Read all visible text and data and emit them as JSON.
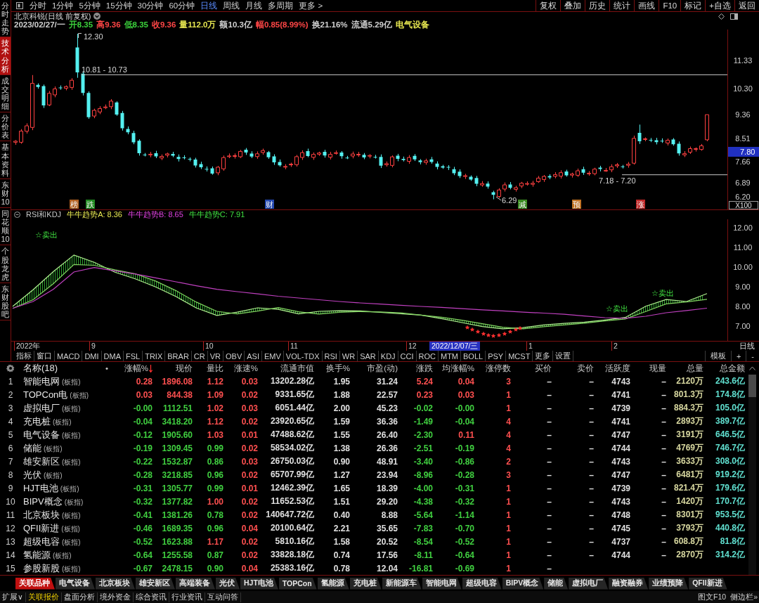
{
  "sidebar": {
    "tabs": [
      {
        "label": "分时走势",
        "selected": false
      },
      {
        "label": "技术分析",
        "selected": true
      },
      {
        "label": "成交明细",
        "selected": false
      },
      {
        "label": "分价表",
        "selected": false
      },
      {
        "label": "基本资料",
        "selected": false
      },
      {
        "label": "东财10",
        "selected": false
      },
      {
        "label": "同花顺10",
        "selected": false
      },
      {
        "label": "个股龙虎",
        "selected": false
      },
      {
        "label": "东财股吧",
        "selected": false
      }
    ]
  },
  "toolbar": {
    "periods": [
      {
        "label": "分时",
        "selected": false
      },
      {
        "label": "1分钟",
        "selected": false
      },
      {
        "label": "5分钟",
        "selected": false
      },
      {
        "label": "15分钟",
        "selected": false
      },
      {
        "label": "30分钟",
        "selected": false
      },
      {
        "label": "60分钟",
        "selected": false
      },
      {
        "label": "日线",
        "selected": true
      },
      {
        "label": "周线",
        "selected": false
      },
      {
        "label": "月线",
        "selected": false
      },
      {
        "label": "多周期",
        "selected": false
      },
      {
        "label": "更多 >",
        "selected": false
      }
    ],
    "buttons": [
      "复权",
      "叠加",
      "历史",
      "统计",
      "画线",
      "F10",
      "标记",
      "+自选",
      "返回"
    ]
  },
  "chart_header": {
    "title": "北京科锐(日线 前复权)",
    "quote": [
      {
        "text": "2023/02/27/一",
        "color": "#d0d0d0"
      },
      {
        "text": "开8.35",
        "color": "#3cd23c"
      },
      {
        "text": "高9.36",
        "color": "#ff4646"
      },
      {
        "text": "低8.35",
        "color": "#3cd23c"
      },
      {
        "text": "收9.36",
        "color": "#ff4646"
      },
      {
        "text": "量112.0万",
        "color": "#e6e650"
      },
      {
        "text": "额10.3亿",
        "color": "#d0d0d0"
      },
      {
        "text": "幅0.85(8.99%)",
        "color": "#ff4646"
      },
      {
        "text": "换21.16%",
        "color": "#d0d0d0"
      },
      {
        "text": "流通5.29亿",
        "color": "#d0d0d0"
      },
      {
        "text": "电气设备",
        "color": "#e6e650"
      }
    ]
  },
  "price_chart": {
    "annotations": [
      "12.30",
      "10.81 - 10.73",
      "7.18 - 7.20",
      "6.29"
    ],
    "event_marks": [
      {
        "text": "榜",
        "color": "#b06020"
      },
      {
        "text": "跌",
        "color": "#208a20"
      },
      {
        "text": "财",
        "color": "#2448b0"
      },
      {
        "text": "减",
        "color": "#3a8a20"
      },
      {
        "text": "预",
        "color": "#c07020"
      },
      {
        "text": "涨",
        "color": "#c02828"
      }
    ],
    "axis_labels": [
      "11.33",
      "10.30",
      "9.36",
      "8.51",
      "7.66",
      "6.89",
      "6.20"
    ],
    "last_price": "7.80",
    "scale": "X100"
  },
  "indicator": {
    "title": "RSI和KDJ",
    "legend": [
      {
        "text": "牛牛趋势A: 8.36",
        "color": "#e6e650"
      },
      {
        "text": "牛牛趋势B: 8.65",
        "color": "#e040e0"
      },
      {
        "text": "牛牛趋势C: 7.91",
        "color": "#40e040"
      }
    ],
    "signals": [
      "☆卖出",
      "☆卖出",
      "☆卖出"
    ],
    "chart_data": {
      "type": "line",
      "series": [
        {
          "color": "#b0f090",
          "values": [
            8.0,
            8.85,
            9.78,
            10.61,
            10.24,
            9.74,
            9.4,
            8.99,
            8.5,
            7.92,
            7.54,
            7.71,
            7.93,
            7.85,
            7.62,
            7.75,
            7.78,
            7.77,
            7.7,
            7.63,
            7.56,
            7.38,
            7.18,
            6.98,
            6.86,
            6.92,
            7.06,
            7.14,
            7.2,
            7.31,
            7.44,
            8.01,
            8.35,
            8.25,
            8.65
          ]
        },
        {
          "color": "#80d060",
          "values": [
            7.9,
            8.34,
            9.16,
            10.13,
            10.09,
            9.86,
            9.66,
            9.29,
            8.8,
            8.22,
            7.75,
            7.62,
            7.76,
            7.94,
            7.73,
            7.61,
            7.7,
            7.74,
            7.72,
            7.67,
            7.56,
            7.45,
            7.3,
            7.12,
            6.94,
            6.86,
            6.97,
            7.06,
            7.15,
            7.26,
            7.36,
            7.74,
            8.13,
            8.23,
            8.36
          ]
        },
        {
          "color": "#c040c0",
          "values": [
            7.9,
            8.25,
            8.88,
            9.75,
            9.98,
            9.81,
            9.65,
            9.45,
            9.25,
            9.05,
            8.87,
            8.75,
            8.64,
            8.52,
            8.43,
            8.34,
            8.25,
            8.18,
            8.12,
            8.06,
            8.0,
            7.95,
            7.89,
            7.83,
            7.77,
            7.71,
            7.66,
            7.6,
            7.51,
            7.43,
            7.4,
            7.5,
            7.68,
            7.79,
            7.91
          ]
        }
      ],
      "ylim": [
        6.25,
        12.43
      ],
      "yticks": [
        {
          "value": 12,
          "label": "12.00"
        },
        {
          "value": 11,
          "label": "11.00"
        },
        {
          "value": 10,
          "label": "10.00"
        },
        {
          "value": 9,
          "label": "9.00"
        },
        {
          "value": 8,
          "label": "8.00"
        },
        {
          "value": 7,
          "label": "7.00"
        }
      ]
    }
  },
  "time_axis": {
    "labels": [
      {
        "text": "2022年",
        "kind": "tick"
      },
      {
        "text": "9",
        "kind": "tick"
      },
      {
        "text": "10",
        "kind": "tick"
      },
      {
        "text": "11",
        "kind": "tick"
      },
      {
        "text": "12",
        "kind": "tick"
      },
      {
        "text": "2022/12/07/三",
        "kind": "cursor"
      },
      {
        "text": "1",
        "kind": "tick"
      },
      {
        "text": "2",
        "kind": "tick"
      }
    ],
    "period": "日线"
  },
  "indicator_tabs": {
    "items": [
      "指标",
      "窗口",
      "MACD",
      "DMI",
      "DMA",
      "FSL",
      "TRIX",
      "BRAR",
      "CR",
      "VR",
      "OBV",
      "ASI",
      "EMV",
      "VOL-TDX",
      "RSI",
      "WR",
      "SAR",
      "KDJ",
      "CCI",
      "ROC",
      "MTM",
      "BOLL",
      "PSY",
      "MCST",
      "更多",
      "设置"
    ],
    "tools": [
      "模板",
      "+",
      "-"
    ]
  },
  "table": {
    "name_header": "名称(18)",
    "marker": "•",
    "columns": [
      {
        "label": "涨幅%",
        "sorted": true
      },
      {
        "label": "现价",
        "sorted": false
      },
      {
        "label": "量比",
        "sorted": false
      },
      {
        "label": "涨速%",
        "sorted": false
      },
      {
        "label": "流通市值",
        "sorted": false
      },
      {
        "label": "换手%",
        "sorted": false
      },
      {
        "label": "市盈(动)",
        "sorted": false
      },
      {
        "label": "涨跌",
        "sorted": false
      },
      {
        "label": "均涨幅%",
        "sorted": false
      },
      {
        "label": "涨停数",
        "sorted": false
      },
      {
        "label": "买价",
        "sorted": false
      },
      {
        "label": "卖价",
        "sorted": false
      },
      {
        "label": "活跃度",
        "sorted": false
      },
      {
        "label": "现量",
        "sorted": false
      },
      {
        "label": "总量",
        "sorted": false
      },
      {
        "label": "总金额",
        "sorted": false
      }
    ],
    "rows": [
      {
        "index": "1",
        "name": "智能电网",
        "tag": "(板指)",
        "cells": [
          {
            "text": "0.28",
            "color": "#ff5050"
          },
          {
            "text": "1896.08",
            "color": "#ff5050"
          },
          {
            "text": "1.12",
            "color": "#ff5050"
          },
          {
            "text": "0.03",
            "color": "#ff5050"
          },
          {
            "text": "13202.28亿",
            "color": "#e0e0e0"
          },
          {
            "text": "1.95",
            "color": "#e0e0e0"
          },
          {
            "text": "31.24",
            "color": "#e0e0e0"
          },
          {
            "text": "5.24",
            "color": "#ff5050"
          },
          {
            "text": "0.04",
            "color": "#ff5050"
          },
          {
            "text": "3",
            "color": "#ff5050"
          },
          {
            "text": "–",
            "color": "#e0e0e0"
          },
          {
            "text": "–",
            "color": "#e0e0e0"
          },
          {
            "text": "4743",
            "color": "#e0e0e0"
          },
          {
            "text": "–",
            "color": "#e0e0e0"
          },
          {
            "text": "2120万",
            "color": "#d8d8a0"
          },
          {
            "text": "243.6亿",
            "color": "#60e0d0"
          }
        ]
      },
      {
        "index": "2",
        "name": "TOPCon电",
        "tag": "(板指)",
        "cells": [
          {
            "text": "0.03",
            "color": "#ff5050"
          },
          {
            "text": "844.38",
            "color": "#ff5050"
          },
          {
            "text": "1.09",
            "color": "#ff5050"
          },
          {
            "text": "0.02",
            "color": "#ff5050"
          },
          {
            "text": "9331.65亿",
            "color": "#e0e0e0"
          },
          {
            "text": "1.88",
            "color": "#e0e0e0"
          },
          {
            "text": "22.57",
            "color": "#e0e0e0"
          },
          {
            "text": "0.23",
            "color": "#ff5050"
          },
          {
            "text": "0.03",
            "color": "#ff5050"
          },
          {
            "text": "1",
            "color": "#ff5050"
          },
          {
            "text": "–",
            "color": "#e0e0e0"
          },
          {
            "text": "–",
            "color": "#e0e0e0"
          },
          {
            "text": "4741",
            "color": "#e0e0e0"
          },
          {
            "text": "–",
            "color": "#e0e0e0"
          },
          {
            "text": "801.3万",
            "color": "#d8d8a0"
          },
          {
            "text": "174.8亿",
            "color": "#60e0d0"
          }
        ]
      },
      {
        "index": "3",
        "name": "虚拟电厂",
        "tag": "(板指)",
        "cells": [
          {
            "text": "-0.00",
            "color": "#40d040"
          },
          {
            "text": "1112.51",
            "color": "#40d040"
          },
          {
            "text": "1.02",
            "color": "#ff5050"
          },
          {
            "text": "0.03",
            "color": "#ff5050"
          },
          {
            "text": "6051.44亿",
            "color": "#e0e0e0"
          },
          {
            "text": "2.00",
            "color": "#e0e0e0"
          },
          {
            "text": "45.23",
            "color": "#e0e0e0"
          },
          {
            "text": "-0.02",
            "color": "#40d040"
          },
          {
            "text": "-0.00",
            "color": "#40d040"
          },
          {
            "text": "1",
            "color": "#ff5050"
          },
          {
            "text": "–",
            "color": "#e0e0e0"
          },
          {
            "text": "–",
            "color": "#e0e0e0"
          },
          {
            "text": "4739",
            "color": "#e0e0e0"
          },
          {
            "text": "–",
            "color": "#e0e0e0"
          },
          {
            "text": "884.3万",
            "color": "#d8d8a0"
          },
          {
            "text": "105.0亿",
            "color": "#60e0d0"
          }
        ]
      },
      {
        "index": "4",
        "name": "充电桩",
        "tag": "(板指)",
        "cells": [
          {
            "text": "-0.04",
            "color": "#40d040"
          },
          {
            "text": "3418.20",
            "color": "#40d040"
          },
          {
            "text": "1.12",
            "color": "#ff5050"
          },
          {
            "text": "0.02",
            "color": "#ff5050"
          },
          {
            "text": "23920.65亿",
            "color": "#e0e0e0"
          },
          {
            "text": "1.59",
            "color": "#e0e0e0"
          },
          {
            "text": "36.36",
            "color": "#e0e0e0"
          },
          {
            "text": "-1.49",
            "color": "#40d040"
          },
          {
            "text": "-0.04",
            "color": "#40d040"
          },
          {
            "text": "4",
            "color": "#ff5050"
          },
          {
            "text": "–",
            "color": "#e0e0e0"
          },
          {
            "text": "–",
            "color": "#e0e0e0"
          },
          {
            "text": "4741",
            "color": "#e0e0e0"
          },
          {
            "text": "–",
            "color": "#e0e0e0"
          },
          {
            "text": "2893万",
            "color": "#d8d8a0"
          },
          {
            "text": "389.7亿",
            "color": "#60e0d0"
          }
        ]
      },
      {
        "index": "5",
        "name": "电气设备",
        "tag": "(板指)",
        "cells": [
          {
            "text": "-0.12",
            "color": "#40d040"
          },
          {
            "text": "1905.60",
            "color": "#40d040"
          },
          {
            "text": "1.03",
            "color": "#ff5050"
          },
          {
            "text": "0.01",
            "color": "#ff5050"
          },
          {
            "text": "47488.62亿",
            "color": "#e0e0e0"
          },
          {
            "text": "1.55",
            "color": "#e0e0e0"
          },
          {
            "text": "26.40",
            "color": "#e0e0e0"
          },
          {
            "text": "-2.30",
            "color": "#40d040"
          },
          {
            "text": "0.11",
            "color": "#ff5050"
          },
          {
            "text": "4",
            "color": "#ff5050"
          },
          {
            "text": "–",
            "color": "#e0e0e0"
          },
          {
            "text": "–",
            "color": "#e0e0e0"
          },
          {
            "text": "4747",
            "color": "#e0e0e0"
          },
          {
            "text": "–",
            "color": "#e0e0e0"
          },
          {
            "text": "3191万",
            "color": "#d8d8a0"
          },
          {
            "text": "646.5亿",
            "color": "#60e0d0"
          }
        ]
      },
      {
        "index": "6",
        "name": "储能",
        "tag": "(板指)",
        "cells": [
          {
            "text": "-0.19",
            "color": "#40d040"
          },
          {
            "text": "1309.45",
            "color": "#40d040"
          },
          {
            "text": "0.99",
            "color": "#40d040"
          },
          {
            "text": "0.02",
            "color": "#ff5050"
          },
          {
            "text": "58534.02亿",
            "color": "#e0e0e0"
          },
          {
            "text": "1.38",
            "color": "#e0e0e0"
          },
          {
            "text": "26.36",
            "color": "#e0e0e0"
          },
          {
            "text": "-2.51",
            "color": "#40d040"
          },
          {
            "text": "-0.19",
            "color": "#40d040"
          },
          {
            "text": "4",
            "color": "#ff5050"
          },
          {
            "text": "–",
            "color": "#e0e0e0"
          },
          {
            "text": "–",
            "color": "#e0e0e0"
          },
          {
            "text": "4744",
            "color": "#e0e0e0"
          },
          {
            "text": "–",
            "color": "#e0e0e0"
          },
          {
            "text": "4769万",
            "color": "#d8d8a0"
          },
          {
            "text": "746.7亿",
            "color": "#60e0d0"
          }
        ]
      },
      {
        "index": "7",
        "name": "雄安新区",
        "tag": "(板指)",
        "cells": [
          {
            "text": "-0.22",
            "color": "#40d040"
          },
          {
            "text": "1532.87",
            "color": "#40d040"
          },
          {
            "text": "0.86",
            "color": "#40d040"
          },
          {
            "text": "0.03",
            "color": "#ff5050"
          },
          {
            "text": "26750.03亿",
            "color": "#e0e0e0"
          },
          {
            "text": "0.90",
            "color": "#e0e0e0"
          },
          {
            "text": "48.91",
            "color": "#e0e0e0"
          },
          {
            "text": "-3.40",
            "color": "#40d040"
          },
          {
            "text": "-0.86",
            "color": "#40d040"
          },
          {
            "text": "2",
            "color": "#ff5050"
          },
          {
            "text": "–",
            "color": "#e0e0e0"
          },
          {
            "text": "–",
            "color": "#e0e0e0"
          },
          {
            "text": "4743",
            "color": "#e0e0e0"
          },
          {
            "text": "–",
            "color": "#e0e0e0"
          },
          {
            "text": "3633万",
            "color": "#d8d8a0"
          },
          {
            "text": "308.0亿",
            "color": "#60e0d0"
          }
        ]
      },
      {
        "index": "8",
        "name": "光伏",
        "tag": "(板指)",
        "cells": [
          {
            "text": "-0.28",
            "color": "#40d040"
          },
          {
            "text": "3218.85",
            "color": "#40d040"
          },
          {
            "text": "0.96",
            "color": "#40d040"
          },
          {
            "text": "0.02",
            "color": "#ff5050"
          },
          {
            "text": "65707.99亿",
            "color": "#e0e0e0"
          },
          {
            "text": "1.27",
            "color": "#e0e0e0"
          },
          {
            "text": "23.94",
            "color": "#e0e0e0"
          },
          {
            "text": "-8.96",
            "color": "#40d040"
          },
          {
            "text": "-0.28",
            "color": "#40d040"
          },
          {
            "text": "3",
            "color": "#ff5050"
          },
          {
            "text": "–",
            "color": "#e0e0e0"
          },
          {
            "text": "–",
            "color": "#e0e0e0"
          },
          {
            "text": "4747",
            "color": "#e0e0e0"
          },
          {
            "text": "–",
            "color": "#e0e0e0"
          },
          {
            "text": "6481万",
            "color": "#d8d8a0"
          },
          {
            "text": "919.2亿",
            "color": "#60e0d0"
          }
        ]
      },
      {
        "index": "9",
        "name": "HJT电池",
        "tag": "(板指)",
        "cells": [
          {
            "text": "-0.31",
            "color": "#40d040"
          },
          {
            "text": "1305.77",
            "color": "#40d040"
          },
          {
            "text": "0.99",
            "color": "#40d040"
          },
          {
            "text": "0.01",
            "color": "#ff5050"
          },
          {
            "text": "12462.39亿",
            "color": "#e0e0e0"
          },
          {
            "text": "1.65",
            "color": "#e0e0e0"
          },
          {
            "text": "18.39",
            "color": "#e0e0e0"
          },
          {
            "text": "-4.00",
            "color": "#40d040"
          },
          {
            "text": "-0.31",
            "color": "#40d040"
          },
          {
            "text": "1",
            "color": "#ff5050"
          },
          {
            "text": "–",
            "color": "#e0e0e0"
          },
          {
            "text": "–",
            "color": "#e0e0e0"
          },
          {
            "text": "4739",
            "color": "#e0e0e0"
          },
          {
            "text": "–",
            "color": "#e0e0e0"
          },
          {
            "text": "821.4万",
            "color": "#d8d8a0"
          },
          {
            "text": "179.6亿",
            "color": "#60e0d0"
          }
        ]
      },
      {
        "index": "10",
        "name": "BIPV概念",
        "tag": "(板指)",
        "cells": [
          {
            "text": "-0.32",
            "color": "#40d040"
          },
          {
            "text": "1377.82",
            "color": "#40d040"
          },
          {
            "text": "1.00",
            "color": "#ff5050"
          },
          {
            "text": "0.02",
            "color": "#ff5050"
          },
          {
            "text": "11652.53亿",
            "color": "#e0e0e0"
          },
          {
            "text": "1.51",
            "color": "#e0e0e0"
          },
          {
            "text": "29.20",
            "color": "#e0e0e0"
          },
          {
            "text": "-4.38",
            "color": "#40d040"
          },
          {
            "text": "-0.32",
            "color": "#40d040"
          },
          {
            "text": "1",
            "color": "#ff5050"
          },
          {
            "text": "–",
            "color": "#e0e0e0"
          },
          {
            "text": "–",
            "color": "#e0e0e0"
          },
          {
            "text": "4743",
            "color": "#e0e0e0"
          },
          {
            "text": "–",
            "color": "#e0e0e0"
          },
          {
            "text": "1420万",
            "color": "#d8d8a0"
          },
          {
            "text": "170.7亿",
            "color": "#60e0d0"
          }
        ]
      },
      {
        "index": "11",
        "name": "北京板块",
        "tag": "(板指)",
        "cells": [
          {
            "text": "-0.41",
            "color": "#40d040"
          },
          {
            "text": "1381.26",
            "color": "#40d040"
          },
          {
            "text": "0.78",
            "color": "#40d040"
          },
          {
            "text": "0.02",
            "color": "#ff5050"
          },
          {
            "text": "140647.72亿",
            "color": "#e0e0e0"
          },
          {
            "text": "0.40",
            "color": "#e0e0e0"
          },
          {
            "text": "8.88",
            "color": "#e0e0e0"
          },
          {
            "text": "-5.64",
            "color": "#40d040"
          },
          {
            "text": "-1.14",
            "color": "#40d040"
          },
          {
            "text": "1",
            "color": "#ff5050"
          },
          {
            "text": "–",
            "color": "#e0e0e0"
          },
          {
            "text": "–",
            "color": "#e0e0e0"
          },
          {
            "text": "4748",
            "color": "#e0e0e0"
          },
          {
            "text": "–",
            "color": "#e0e0e0"
          },
          {
            "text": "8301万",
            "color": "#d8d8a0"
          },
          {
            "text": "953.5亿",
            "color": "#60e0d0"
          }
        ]
      },
      {
        "index": "12",
        "name": "QFII新进",
        "tag": "(板指)",
        "cells": [
          {
            "text": "-0.46",
            "color": "#40d040"
          },
          {
            "text": "1689.35",
            "color": "#40d040"
          },
          {
            "text": "0.96",
            "color": "#40d040"
          },
          {
            "text": "0.04",
            "color": "#ff5050"
          },
          {
            "text": "20100.64亿",
            "color": "#e0e0e0"
          },
          {
            "text": "2.21",
            "color": "#e0e0e0"
          },
          {
            "text": "35.65",
            "color": "#e0e0e0"
          },
          {
            "text": "-7.83",
            "color": "#40d040"
          },
          {
            "text": "-0.70",
            "color": "#40d040"
          },
          {
            "text": "1",
            "color": "#ff5050"
          },
          {
            "text": "–",
            "color": "#e0e0e0"
          },
          {
            "text": "–",
            "color": "#e0e0e0"
          },
          {
            "text": "4745",
            "color": "#e0e0e0"
          },
          {
            "text": "–",
            "color": "#e0e0e0"
          },
          {
            "text": "3793万",
            "color": "#d8d8a0"
          },
          {
            "text": "440.8亿",
            "color": "#60e0d0"
          }
        ]
      },
      {
        "index": "13",
        "name": "超级电容",
        "tag": "(板指)",
        "cells": [
          {
            "text": "-0.52",
            "color": "#40d040"
          },
          {
            "text": "1623.88",
            "color": "#40d040"
          },
          {
            "text": "1.17",
            "color": "#ff5050"
          },
          {
            "text": "0.02",
            "color": "#ff5050"
          },
          {
            "text": "5810.16亿",
            "color": "#e0e0e0"
          },
          {
            "text": "1.58",
            "color": "#e0e0e0"
          },
          {
            "text": "20.52",
            "color": "#e0e0e0"
          },
          {
            "text": "-8.54",
            "color": "#40d040"
          },
          {
            "text": "-0.52",
            "color": "#40d040"
          },
          {
            "text": "1",
            "color": "#ff5050"
          },
          {
            "text": "–",
            "color": "#e0e0e0"
          },
          {
            "text": "–",
            "color": "#e0e0e0"
          },
          {
            "text": "4737",
            "color": "#e0e0e0"
          },
          {
            "text": "–",
            "color": "#e0e0e0"
          },
          {
            "text": "608.8万",
            "color": "#d8d8a0"
          },
          {
            "text": "81.8亿",
            "color": "#60e0d0"
          }
        ]
      },
      {
        "index": "14",
        "name": "氢能源",
        "tag": "(板指)",
        "cells": [
          {
            "text": "-0.64",
            "color": "#40d040"
          },
          {
            "text": "1255.58",
            "color": "#40d040"
          },
          {
            "text": "0.87",
            "color": "#40d040"
          },
          {
            "text": "0.02",
            "color": "#ff5050"
          },
          {
            "text": "33828.18亿",
            "color": "#e0e0e0"
          },
          {
            "text": "0.74",
            "color": "#e0e0e0"
          },
          {
            "text": "17.56",
            "color": "#e0e0e0"
          },
          {
            "text": "-8.11",
            "color": "#40d040"
          },
          {
            "text": "-0.64",
            "color": "#40d040"
          },
          {
            "text": "1",
            "color": "#ff5050"
          },
          {
            "text": "–",
            "color": "#e0e0e0"
          },
          {
            "text": "–",
            "color": "#e0e0e0"
          },
          {
            "text": "4744",
            "color": "#e0e0e0"
          },
          {
            "text": "–",
            "color": "#e0e0e0"
          },
          {
            "text": "2870万",
            "color": "#d8d8a0"
          },
          {
            "text": "314.2亿",
            "color": "#60e0d0"
          }
        ]
      },
      {
        "index": "15",
        "name": "参股新股",
        "tag": "(板指)",
        "cells": [
          {
            "text": "-0.67",
            "color": "#40d040"
          },
          {
            "text": "2478.15",
            "color": "#40d040"
          },
          {
            "text": "0.90",
            "color": "#40d040"
          },
          {
            "text": "0.04",
            "color": "#ff5050"
          },
          {
            "text": "25383.16亿",
            "color": "#e0e0e0"
          },
          {
            "text": "0.78",
            "color": "#e0e0e0"
          },
          {
            "text": "12.04",
            "color": "#e0e0e0"
          },
          {
            "text": "-16.81",
            "color": "#40d040"
          },
          {
            "text": "-0.69",
            "color": "#40d040"
          },
          {
            "text": "1",
            "color": "#ff5050"
          },
          {
            "text": "–",
            "color": "#e0e0e0"
          }
        ]
      }
    ]
  },
  "bottom_tabs": [
    {
      "label": "关联品种",
      "selected": true
    },
    {
      "label": "电气设备",
      "selected": false
    },
    {
      "label": "北京板块",
      "selected": false
    },
    {
      "label": "雄安新区",
      "selected": false
    },
    {
      "label": "高端装备",
      "selected": false
    },
    {
      "label": "光伏",
      "selected": false
    },
    {
      "label": "HJT电池",
      "selected": false
    },
    {
      "label": "TOPCon",
      "selected": false
    },
    {
      "label": "氢能源",
      "selected": false
    },
    {
      "label": "充电桩",
      "selected": false
    },
    {
      "label": "新能源车",
      "selected": false
    },
    {
      "label": "智能电网",
      "selected": false
    },
    {
      "label": "超级电容",
      "selected": false
    },
    {
      "label": "BIPV概念",
      "selected": false
    },
    {
      "label": "储能",
      "selected": false
    },
    {
      "label": "虚拟电厂",
      "selected": false
    },
    {
      "label": "融资融券",
      "selected": false
    },
    {
      "label": "业绩预降",
      "selected": false
    },
    {
      "label": "QFII新进",
      "selected": false
    }
  ],
  "status_bar": {
    "items": [
      {
        "label": "扩展∨",
        "selected": false
      },
      {
        "label": "关联报价",
        "selected": true
      },
      {
        "label": "盘面分析",
        "selected": false
      },
      {
        "label": "境外资金",
        "selected": false
      },
      {
        "label": "综合资讯",
        "selected": false
      },
      {
        "label": "行业资讯",
        "selected": false
      },
      {
        "label": "互动问答",
        "selected": false
      }
    ],
    "right": [
      "图文F10",
      "侧边栏»"
    ]
  }
}
